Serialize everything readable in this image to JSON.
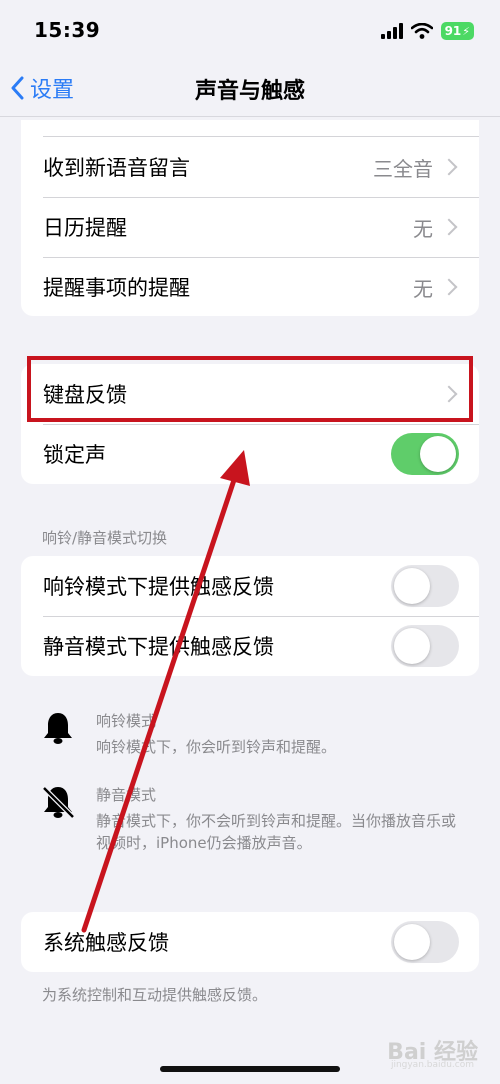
{
  "status_bar": {
    "time": "15:39",
    "battery": "91"
  },
  "nav": {
    "back_label": "设置",
    "title": "声音与触感"
  },
  "group_alerts": [
    {
      "label": "收到新语音留言",
      "value": "三全音"
    },
    {
      "label": "日历提醒",
      "value": "无"
    },
    {
      "label": "提醒事项的提醒",
      "value": "无"
    }
  ],
  "group_keyboard": {
    "keyboard_feedback": "键盘反馈",
    "lock_sound": "锁定声",
    "lock_sound_on": true
  },
  "ring_silent": {
    "header": "响铃/静音模式切换",
    "ring_haptics": "响铃模式下提供触感反馈",
    "silent_haptics": "静音模式下提供触感反馈"
  },
  "modes": {
    "ring_title": "响铃模式",
    "ring_desc": "响铃模式下，你会听到铃声和提醒。",
    "silent_title": "静音模式",
    "silent_desc": "静音模式下，你不会听到铃声和提醒。当你播放音乐或视频时，iPhone仍会播放声音。"
  },
  "system": {
    "label": "系统触感反馈",
    "note": "为系统控制和互动提供触感反馈。"
  },
  "watermark": {
    "brand": "Bai 经验",
    "url": "jingyan.baidu.com"
  },
  "colors": {
    "accent": "#2b7cf6",
    "toggle_on": "#5fcd6a",
    "annotation_red": "#c8141e"
  }
}
